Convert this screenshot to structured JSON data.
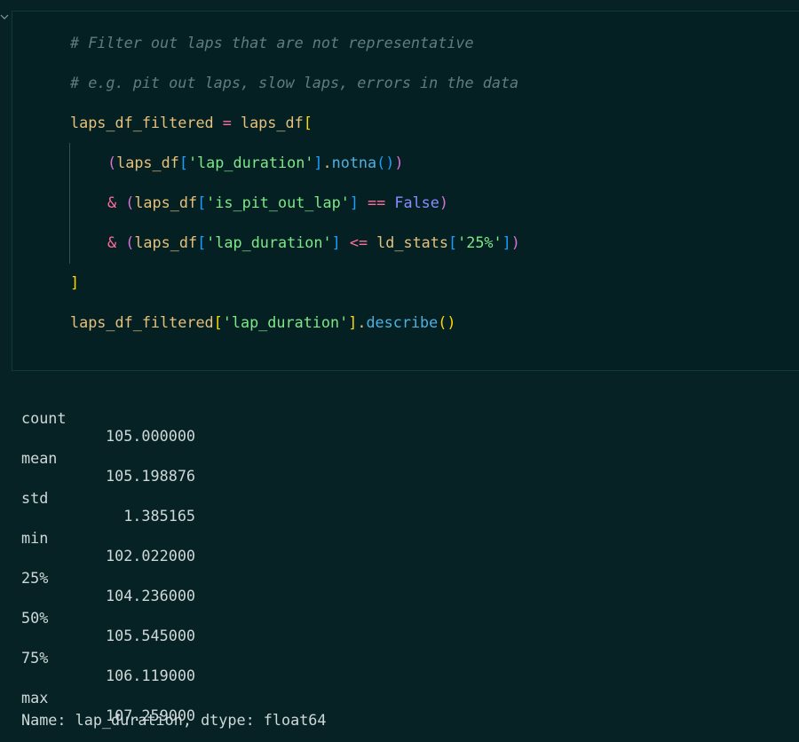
{
  "code_cell": {
    "lines": [
      [
        {
          "t": "# Filter out laps that are not representative",
          "c": "tok-comment"
        }
      ],
      [
        {
          "t": "# e.g. pit out laps, slow laps, errors in the data",
          "c": "tok-comment"
        }
      ],
      [
        {
          "t": "laps_df_filtered ",
          "c": "tok-var"
        },
        {
          "t": "=",
          "c": "tok-op"
        },
        {
          "t": " laps_df",
          "c": "tok-var"
        },
        {
          "t": "[",
          "c": "tok-bracket1"
        }
      ],
      [
        {
          "t": "(",
          "c": "tok-bracket2"
        },
        {
          "t": "laps_df",
          "c": "tok-var"
        },
        {
          "t": "[",
          "c": "tok-bracket3"
        },
        {
          "t": "'lap_duration'",
          "c": "tok-string"
        },
        {
          "t": "]",
          "c": "tok-bracket3"
        },
        {
          "t": ".",
          "c": "tok-var"
        },
        {
          "t": "notna",
          "c": "tok-method"
        },
        {
          "t": "()",
          "c": "tok-bracket3"
        },
        {
          "t": ")",
          "c": "tok-bracket2"
        }
      ],
      [
        {
          "t": "& ",
          "c": "tok-op"
        },
        {
          "t": "(",
          "c": "tok-bracket2"
        },
        {
          "t": "laps_df",
          "c": "tok-var"
        },
        {
          "t": "[",
          "c": "tok-bracket3"
        },
        {
          "t": "'is_pit_out_lap'",
          "c": "tok-string"
        },
        {
          "t": "]",
          "c": "tok-bracket3"
        },
        {
          "t": " ",
          "c": "tok-var"
        },
        {
          "t": "==",
          "c": "tok-op"
        },
        {
          "t": " ",
          "c": "tok-var"
        },
        {
          "t": "False",
          "c": "tok-const"
        },
        {
          "t": ")",
          "c": "tok-bracket2"
        }
      ],
      [
        {
          "t": "& ",
          "c": "tok-op"
        },
        {
          "t": "(",
          "c": "tok-bracket2"
        },
        {
          "t": "laps_df",
          "c": "tok-var"
        },
        {
          "t": "[",
          "c": "tok-bracket3"
        },
        {
          "t": "'lap_duration'",
          "c": "tok-string"
        },
        {
          "t": "]",
          "c": "tok-bracket3"
        },
        {
          "t": " ",
          "c": "tok-var"
        },
        {
          "t": "<=",
          "c": "tok-op"
        },
        {
          "t": " ld_stats",
          "c": "tok-var"
        },
        {
          "t": "[",
          "c": "tok-bracket3"
        },
        {
          "t": "'25%'",
          "c": "tok-string"
        },
        {
          "t": "]",
          "c": "tok-bracket3"
        },
        {
          "t": ")",
          "c": "tok-bracket2"
        }
      ],
      [
        {
          "t": "]",
          "c": "tok-bracket1"
        }
      ],
      [
        {
          "t": "laps_df_filtered",
          "c": "tok-var"
        },
        {
          "t": "[",
          "c": "tok-bracket1"
        },
        {
          "t": "'lap_duration'",
          "c": "tok-string"
        },
        {
          "t": "]",
          "c": "tok-bracket1"
        },
        {
          "t": ".",
          "c": "tok-var"
        },
        {
          "t": "describe",
          "c": "tok-method"
        },
        {
          "t": "()",
          "c": "tok-bracket1"
        }
      ]
    ]
  },
  "output": {
    "rows": [
      {
        "label": "count",
        "value": "105.000000"
      },
      {
        "label": "mean",
        "value": "105.198876"
      },
      {
        "label": "std",
        "value": "  1.385165"
      },
      {
        "label": "min",
        "value": "102.022000"
      },
      {
        "label": "25%",
        "value": "104.236000"
      },
      {
        "label": "50%",
        "value": "105.545000"
      },
      {
        "label": "75%",
        "value": "106.119000"
      },
      {
        "label": "max",
        "value": "107.259000"
      }
    ],
    "footer": "Name: lap_duration, dtype: float64"
  },
  "icons": {
    "collapse": "chevron-down-icon"
  }
}
